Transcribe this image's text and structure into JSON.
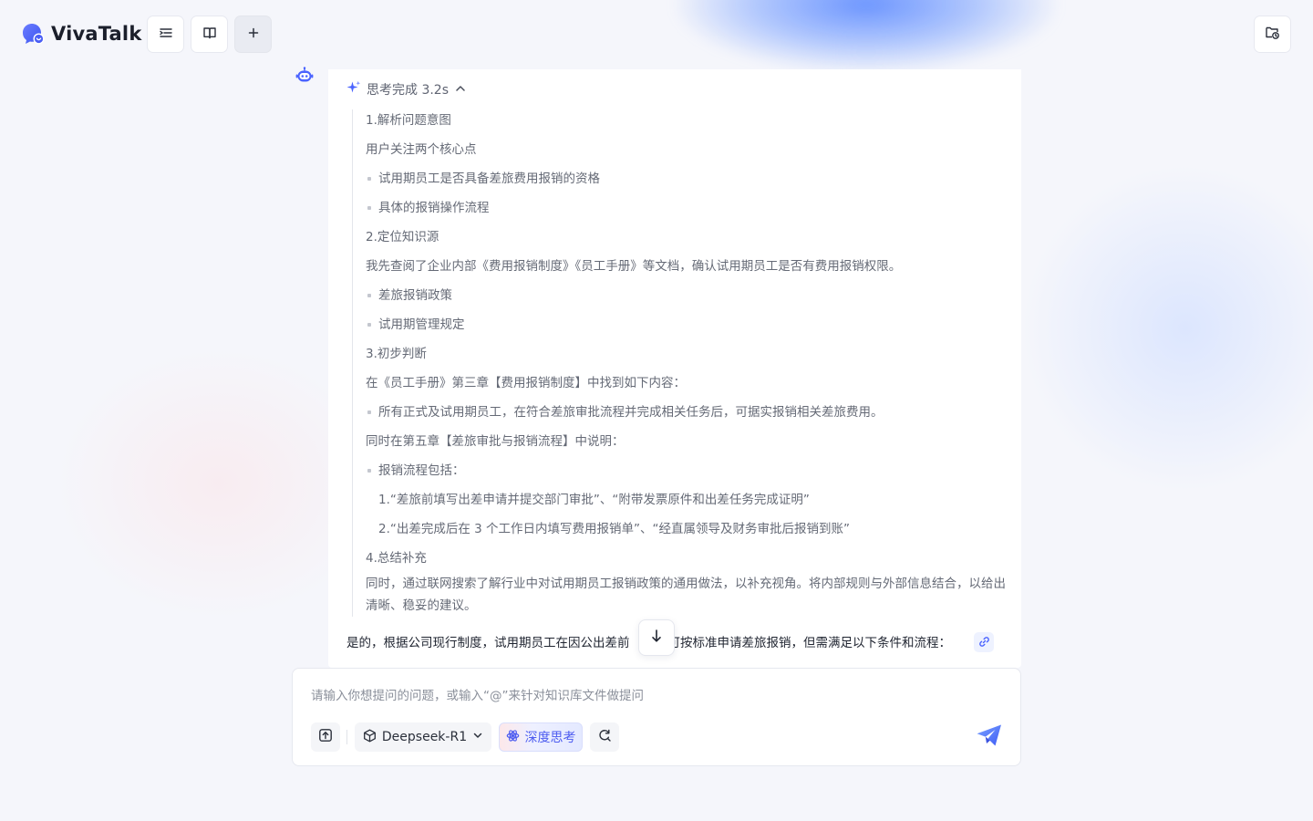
{
  "app": {
    "name": "VivaTalk"
  },
  "colors": {
    "accent": "#4d6bff",
    "brand": "#5468ff"
  },
  "header": {
    "buttons": [
      {
        "icon": "menu-list-icon"
      },
      {
        "icon": "book-icon"
      },
      {
        "icon": "plus-icon"
      },
      {
        "icon": "folder-history-icon"
      }
    ]
  },
  "thinking": {
    "title": "思考完成 3.2s",
    "lines": [
      {
        "kind": "heading",
        "text": "1.解析问题意图"
      },
      {
        "kind": "text",
        "text": "用户关注两个核心点"
      },
      {
        "kind": "bullet",
        "text": "试用期员工是否具备差旅费用报销的资格"
      },
      {
        "kind": "bullet",
        "text": "具体的报销操作流程"
      },
      {
        "kind": "heading",
        "text": "2.定位知识源"
      },
      {
        "kind": "text",
        "text": "我先查阅了企业内部《费用报销制度》《员工手册》等文档，确认试用期员工是否有费用报销权限。"
      },
      {
        "kind": "bullet",
        "text": "差旅报销政策"
      },
      {
        "kind": "bullet",
        "text": "试用期管理规定"
      },
      {
        "kind": "heading",
        "text": "3.初步判断"
      },
      {
        "kind": "text",
        "text": "在《员工手册》第三章【费用报销制度】中找到如下内容："
      },
      {
        "kind": "bullet",
        "text": "所有正式及试用期员工，在符合差旅审批流程并完成相关任务后，可据实报销相关差旅费用。"
      },
      {
        "kind": "text",
        "text": "同时在第五章【差旅审批与报销流程】中说明："
      },
      {
        "kind": "bullet",
        "text": "报销流程包括："
      },
      {
        "kind": "sub",
        "text": "1.“差旅前填写出差申请并提交部门审批”、“附带发票原件和出差任务完成证明”"
      },
      {
        "kind": "sub",
        "text": "2.“出差完成后在 3 个工作日内填写费用报销单”、“经直属领导及财务审批后报销到账”"
      },
      {
        "kind": "heading",
        "text": "4.总结补充"
      },
      {
        "kind": "wrap",
        "text": "同时，通过联网搜索了解行业中对试用期员工报销政策的通用做法，以补充视角。将内部规则与外部信息结合，以给出清晰、稳妥的建议。"
      }
    ]
  },
  "answer": {
    "part1": "是的，根据公司现行制度，试用期员工在因公出差前",
    "part2": "可按标准申请差旅报销，但需满足以下条件和流程："
  },
  "input": {
    "placeholder": "请输入你想提问的问题，或输入“@”来针对知识库文件做提问",
    "model": "Deepseek-R1",
    "deep_think_label": "深度思考"
  }
}
